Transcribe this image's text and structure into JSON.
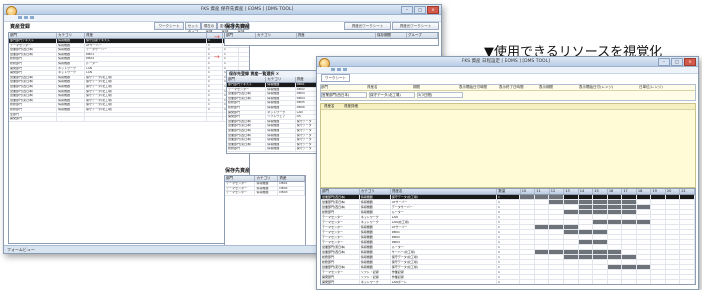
{
  "caption": "▼使用できるリソースを視覚化",
  "win1": {
    "title": "FKS 資産 保存先資産 [ EOMS ] [DMS TOOL]",
    "section_title": "資産登録",
    "worksheet_btn": "ワークシート",
    "col_buttons": [
      "セット タイプ",
      "現在の 状態",
      "変化前 状態",
      "変化後 状態"
    ],
    "columns": [
      "部門",
      "カテゴリ",
      "資産",
      "",
      ""
    ],
    "rows": [
      [
        "部門部門テキスト",
        "情報機器",
        "保守資産テキスト",
        "1",
        "1"
      ],
      [
        "テーマセンター",
        "情報機器",
        "ATサーバー",
        "1",
        "1"
      ],
      [
        "営業部門(西日本)",
        "情報機器",
        "データサーバー",
        "1",
        "1"
      ],
      [
        "営業部門(東日本)",
        "情報機器",
        "DB01",
        "1",
        "1"
      ],
      [
        "総務部門",
        "情報機器",
        "DB02",
        "1",
        "1"
      ],
      [
        "総務部門",
        "情報機器",
        "ルーター",
        "1",
        "1"
      ],
      [
        "開発部門",
        "ネットワーク",
        "LAN",
        "1",
        "1"
      ],
      [
        "開発部門",
        "ネットワーク",
        "LAN",
        "1",
        "1"
      ],
      [
        "営業部門(西日本)",
        "情報機器",
        "保守データ(北工場)",
        "1",
        "1"
      ],
      [
        "営業部門(東日本)",
        "情報機器",
        "保守データ(北工場)",
        "1",
        "1"
      ],
      [
        "営業部門(西日本)",
        "情報機器",
        "保守データ(北工場)",
        "1",
        "1"
      ],
      [
        "営業部門(西日本)",
        "情報機器",
        "保守データ(北工場)",
        "1",
        "1"
      ],
      [
        "営業部門(東日本)",
        "情報機器",
        "保守データ(北工場)",
        "1",
        "1"
      ],
      [
        "営業部門(東日本)",
        "情報機器",
        "保守データ(北工場)",
        "1",
        "1"
      ],
      [
        "総務部門",
        "情報機器",
        "保守データ(北工場)",
        "1",
        "1"
      ],
      [
        "総務部門",
        "情報機器",
        "保守データ(北工場)",
        "1",
        "1"
      ],
      [
        "全部門",
        "",
        "",
        "",
        ""
      ],
      [
        "開発部門",
        "",
        "",
        "",
        ""
      ]
    ],
    "right_title": "保存先資産",
    "right_btn1": "資産元ワークシート",
    "right_btn2": "資産元ワークシート",
    "right_columns": [
      "部門",
      "カテゴリ",
      "資産",
      "保存期間",
      "グループ"
    ],
    "popup_title": "保存先登録 資産一覧選択 ×",
    "popup_columns": [
      "部門",
      "カテゴリ",
      "資産"
    ],
    "popup_rows": [
      [
        "部門部門テキスト",
        "情報機器",
        "DB01"
      ],
      [
        "テーマセンター",
        "情報機器",
        "DB02"
      ],
      [
        "営業部門(西日本)",
        "情報機器",
        "DB03"
      ],
      [
        "営業部門(東日本)",
        "情報機器",
        "DB04"
      ],
      [
        "総務部門",
        "情報機器",
        "DB05"
      ],
      [
        "総務部門",
        "情報機器",
        "DB06"
      ],
      [
        "開発部門",
        "ネットワーク",
        "LAN"
      ],
      [
        "開発部門",
        "ソフトウェア",
        "OS"
      ],
      [
        "営業部門(西日本)",
        "情報機器",
        "保守データ"
      ],
      [
        "営業部門(東日本)",
        "情報機器",
        "保守データ"
      ],
      [
        "営業部門(西日本)",
        "情報機器",
        "保守データ"
      ],
      [
        "営業部門(西日本)",
        "情報機器",
        "保守データ"
      ],
      [
        "営業部門(東日本)",
        "情報機器",
        "保守データ"
      ],
      [
        "営業部門(東日本)",
        "情報機器",
        "保守データ"
      ],
      [
        "総務部門",
        "情報機器",
        "保守データ"
      ]
    ],
    "bottom_title": "保存先資産",
    "bottom_columns": [
      "部門",
      "カテゴリ",
      "資産"
    ],
    "bottom_rows": [
      [
        "テーマセンター",
        "情報機器",
        "DB01"
      ],
      [
        "テーマセンター",
        "情報機器",
        "DB02"
      ],
      [
        "テーマセンター",
        "情報機器",
        "DB03"
      ]
    ],
    "status": "フォームビュー"
  },
  "win2": {
    "title": "FKS 資産 日程設定 [ EOMS ] [DMS TOOL]",
    "tab": "ワークシート",
    "filter_labels": [
      "部門",
      "資産名",
      "期間",
      "表示開始日付時間",
      "表示終了日時間",
      "表示期間",
      "表示開始日付(レンジ)",
      "日単位(レンジ)"
    ],
    "filter_values": [
      "営業部門(西日本)",
      "保守データ(北工場)",
      "3(3日間)"
    ],
    "memo_labels": [
      "資産名",
      "資産詳細"
    ],
    "timeline_columns": [
      "部門",
      "カテゴリ",
      "資産名",
      "数量"
    ],
    "timeline_days": [
      "10",
      "11",
      "12",
      "13",
      "14",
      "15",
      "16",
      "17",
      "18",
      "19",
      "20",
      "21"
    ],
    "timeline_rows": [
      {
        "dept": "営業部門(西日本)",
        "cat": "情報機器",
        "name": "保守データ(北工場)",
        "qty": "1",
        "fill": [
          1,
          1,
          1,
          0,
          0,
          0,
          0,
          0,
          0,
          0,
          0,
          0
        ],
        "sel": true
      },
      {
        "dept": "営業部門(東日本)",
        "cat": "情報機器",
        "name": "ATサーバー",
        "qty": "1",
        "fill": [
          0,
          0,
          1,
          1,
          1,
          1,
          1,
          1,
          0,
          0,
          0,
          0
        ],
        "sel": false
      },
      {
        "dept": "営業部門(西日本)",
        "cat": "情報機器",
        "name": "データサーバー",
        "qty": "1",
        "fill": [
          0,
          0,
          0,
          0,
          1,
          1,
          1,
          1,
          1,
          0,
          0,
          0
        ],
        "sel": false
      },
      {
        "dept": "総務部門",
        "cat": "情報機器",
        "name": "ルーター",
        "qty": "1",
        "fill": [
          0,
          0,
          0,
          1,
          1,
          1,
          1,
          1,
          0,
          0,
          0,
          0
        ],
        "sel": false
      },
      {
        "dept": "テーマセンター",
        "cat": "ネットワーク",
        "name": "LAN",
        "qty": "1",
        "fill": [
          0,
          0,
          0,
          0,
          0,
          0,
          0,
          0,
          0,
          0,
          0,
          0
        ],
        "sel": false
      },
      {
        "dept": "テーマセンター",
        "cat": "ネットワーク",
        "name": "LAN(北工場)",
        "qty": "1",
        "fill": [
          0,
          0,
          0,
          0,
          0,
          1,
          1,
          1,
          1,
          0,
          0,
          0
        ],
        "sel": false
      },
      {
        "dept": "テーマセンター",
        "cat": "情報機器",
        "name": "ATサーバー",
        "qty": "1",
        "fill": [
          0,
          1,
          1,
          1,
          0,
          0,
          0,
          0,
          0,
          0,
          0,
          0
        ],
        "sel": false
      },
      {
        "dept": "テーマセンター",
        "cat": "情報機器",
        "name": "DB01",
        "qty": "1",
        "fill": [
          0,
          0,
          0,
          1,
          1,
          1,
          0,
          0,
          0,
          0,
          0,
          0
        ],
        "sel": false
      },
      {
        "dept": "テーマセンター",
        "cat": "情報機器",
        "name": "DB02",
        "qty": "1",
        "fill": [
          0,
          0,
          0,
          0,
          0,
          0,
          0,
          0,
          0,
          0,
          0,
          0
        ],
        "sel": false
      },
      {
        "dept": "テーマセンター",
        "cat": "情報機器",
        "name": "DB03",
        "qty": "1",
        "fill": [
          0,
          0,
          0,
          0,
          1,
          1,
          0,
          0,
          0,
          0,
          0,
          0
        ],
        "sel": false
      },
      {
        "dept": "営業部門(東日本)",
        "cat": "情報機器",
        "name": "ルーター",
        "qty": "1",
        "fill": [
          0,
          0,
          0,
          0,
          0,
          0,
          0,
          0,
          0,
          0,
          0,
          0
        ],
        "sel": false
      },
      {
        "dept": "営業部門(西日本)",
        "cat": "情報機器",
        "name": "サーバー(北工場)",
        "qty": "1",
        "fill": [
          0,
          1,
          1,
          1,
          1,
          1,
          1,
          0,
          0,
          0,
          0,
          0
        ],
        "sel": false
      },
      {
        "dept": "総務部門",
        "cat": "情報機器",
        "name": "保守データ(北工場)",
        "qty": "1",
        "fill": [
          0,
          0,
          0,
          1,
          1,
          1,
          1,
          1,
          0,
          0,
          0,
          0
        ],
        "sel": false
      },
      {
        "dept": "総務部門",
        "cat": "情報機器",
        "name": "保守データ(北工場)",
        "qty": "1",
        "fill": [
          0,
          0,
          0,
          0,
          0,
          0,
          0,
          0,
          0,
          0,
          0,
          0
        ],
        "sel": false
      },
      {
        "dept": "営業部門(東日本)",
        "cat": "情報機器",
        "name": "保守データ(北工場)",
        "qty": "1",
        "fill": [
          0,
          0,
          0,
          0,
          0,
          0,
          1,
          1,
          1,
          0,
          0,
          0
        ],
        "sel": false
      },
      {
        "dept": "テーマセンター",
        "cat": "ソフト・記録",
        "name": "作業記録",
        "qty": "1",
        "fill": [
          0,
          0,
          0,
          0,
          0,
          0,
          0,
          0,
          0,
          0,
          0,
          0
        ],
        "sel": false
      },
      {
        "dept": "開発部門",
        "cat": "ソフト・記録",
        "name": "作業記録",
        "qty": "1",
        "fill": [
          0,
          0,
          0,
          0,
          0,
          0,
          0,
          0,
          0,
          0,
          0,
          0
        ],
        "sel": false
      },
      {
        "dept": "開発部門",
        "cat": "ネットワーク",
        "name": "LANポート",
        "qty": "1",
        "fill": [
          0,
          0,
          0,
          0,
          0,
          0,
          0,
          0,
          0,
          0,
          0,
          0
        ],
        "sel": false
      },
      {
        "dept": "総務部門",
        "cat": "ネットワーク",
        "name": "保守業務(東日本)",
        "qty": "1",
        "fill": [
          0,
          0,
          0,
          0,
          0,
          0,
          0,
          0,
          0,
          0,
          0,
          0
        ],
        "sel": false
      }
    ]
  }
}
